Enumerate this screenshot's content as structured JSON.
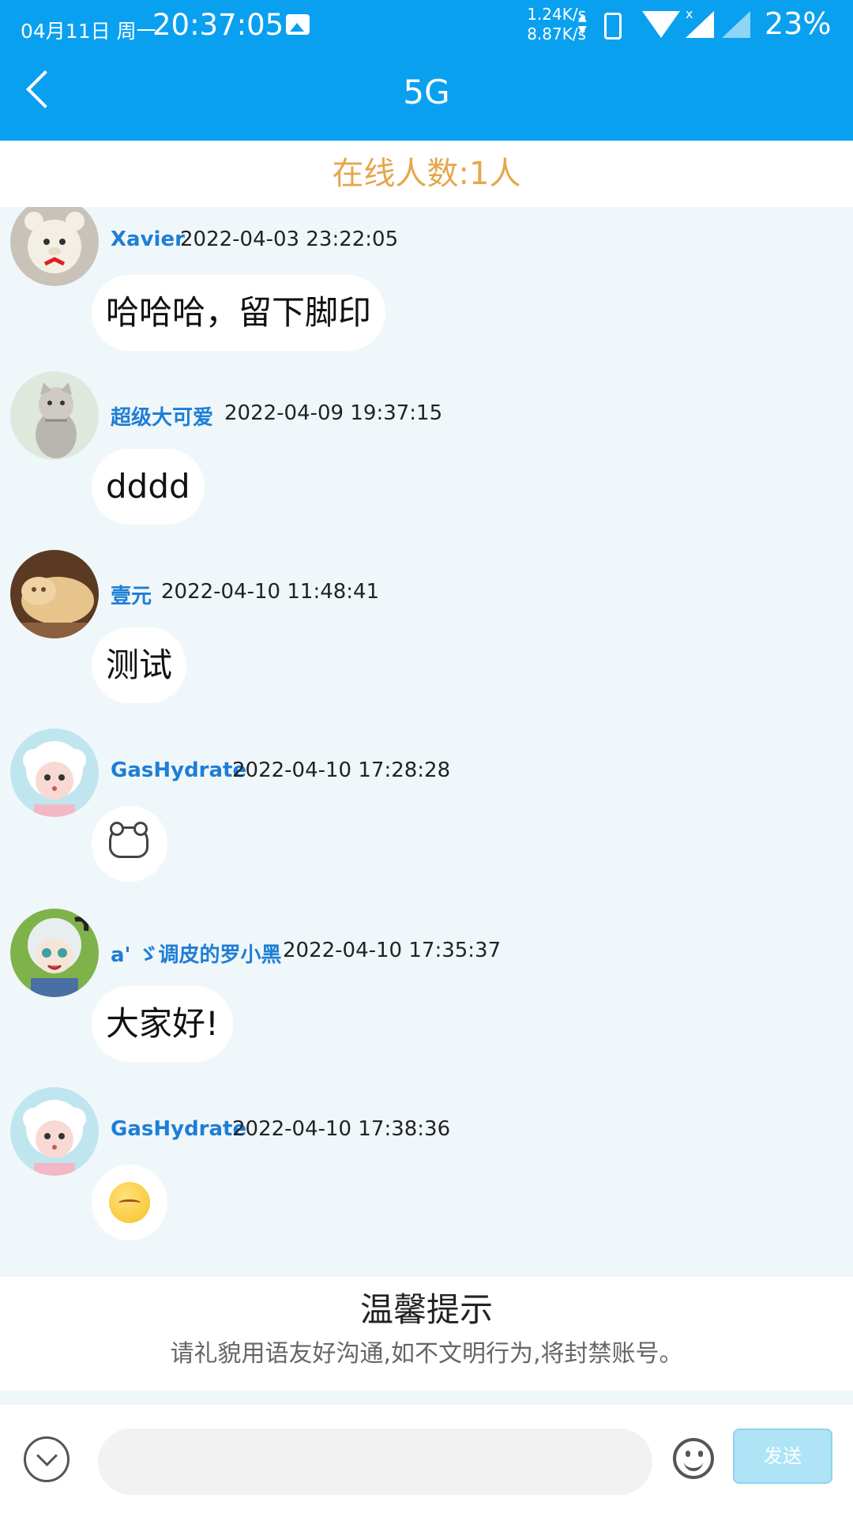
{
  "status_bar": {
    "date": "04月11日 周一",
    "time": "20:37:05",
    "speed_up": "1.24K/s",
    "speed_down": "8.87K/s",
    "battery": "23%"
  },
  "header": {
    "title": "5G"
  },
  "online": {
    "text": "在线人数:1人"
  },
  "messages": [
    {
      "user": "Xavier",
      "time": "2022-04-03 23:22:05",
      "text": "哈哈哈，留下脚印",
      "avatar": "teddy-bear-avatar"
    },
    {
      "user": "超级大可爱",
      "time": "2022-04-09 19:37:15",
      "text": "dddd",
      "avatar": "cat-avatar"
    },
    {
      "user": "壹元",
      "time": "2022-04-10 11:48:41",
      "text": "测试",
      "avatar": "cat-lying-avatar"
    },
    {
      "user": "GasHydrate",
      "time": "2022-04-10 17:28:28",
      "sticker": "bear-sticker",
      "avatar": "sheep-cartoon-avatar"
    },
    {
      "user": "a' ゞ调皮的罗小黑",
      "time": "2022-04-10 17:35:37",
      "text": "大家好!",
      "avatar": "cartoon-character-avatar"
    },
    {
      "user": "GasHydrate",
      "time": "2022-04-10 17:38:36",
      "sticker": "shy-face-emoji",
      "avatar": "sheep-cartoon-avatar"
    }
  ],
  "tip": {
    "title": "温馨提示",
    "text": "请礼貌用语友好沟通,如不文明行为,将封禁账号。"
  },
  "input_bar": {
    "placeholder": "",
    "send_label": "发送"
  },
  "colors": {
    "header": "#0aa0f0",
    "online_text": "#e6a64c",
    "username": "#1e7ed6",
    "chat_bg": "#f0f7fa",
    "send_button": "#aee4f6"
  }
}
